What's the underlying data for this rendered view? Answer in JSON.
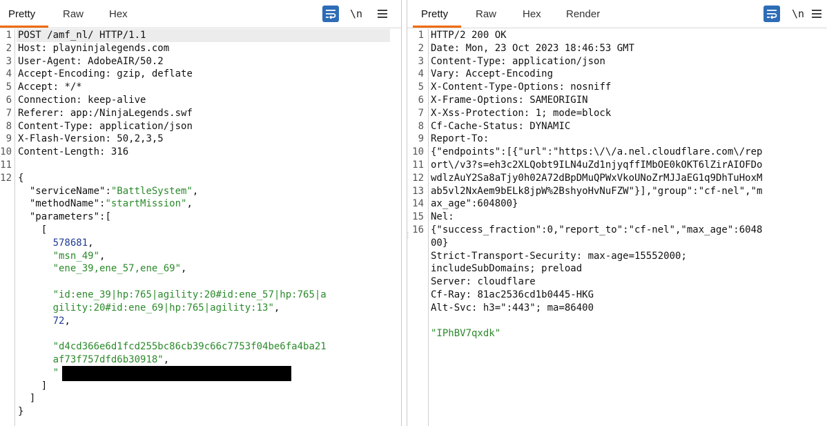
{
  "request": {
    "tabs": [
      {
        "label": "Pretty",
        "active": true
      },
      {
        "label": "Raw",
        "active": false
      },
      {
        "label": "Hex",
        "active": false
      }
    ],
    "newline_label": "\\n",
    "line_numbers": [
      "1",
      "2",
      "3",
      "4",
      "5",
      "6",
      "7",
      "8",
      "9",
      "10",
      "11",
      "12"
    ],
    "request_line": "POST /amf_nl/ HTTP/1.1",
    "headers": [
      {
        "name": "Host",
        "value": "playninjalegends.com"
      },
      {
        "name": "User-Agent",
        "value": "AdobeAIR/50.2"
      },
      {
        "name": "Accept-Encoding",
        "value": "gzip, deflate"
      },
      {
        "name": "Accept",
        "value": "*/*"
      },
      {
        "name": "Connection",
        "value": "keep-alive"
      },
      {
        "name": "Referer",
        "value": "app:/NinjaLegends.swf"
      },
      {
        "name": "Content-Type",
        "value": "application/json"
      },
      {
        "name": "X-Flash-Version",
        "value": "50,2,3,5"
      },
      {
        "name": "Content-Length",
        "value": "316"
      }
    ],
    "body": {
      "serviceName_key": "\"serviceName\"",
      "serviceName_val": "\"BattleSystem\"",
      "methodName_key": "\"methodName\"",
      "methodName_val": "\"startMission\"",
      "parameters_key": "\"parameters\"",
      "p1": "578681",
      "p2": "\"msn_49\"",
      "p3": "\"ene_39,ene_57,ene_69\"",
      "p4_line1": "\"id:ene_39|hp:765|agility:20#id:ene_57|hp:765|a",
      "p4_line2": "gility:20#id:ene_69|hp:765|agility:13\"",
      "p5": "72",
      "p6_line1": "\"d4cd366e6d1fcd255bc86cb39c66c7753f04be6fa4ba21",
      "p6_line2": "af73f757dfd6b30918\""
    }
  },
  "response": {
    "tabs": [
      {
        "label": "Pretty",
        "active": true
      },
      {
        "label": "Raw",
        "active": false
      },
      {
        "label": "Hex",
        "active": false
      },
      {
        "label": "Render",
        "active": false
      }
    ],
    "newline_label": "\\n",
    "status_line": "HTTP/2 200 OK",
    "headers": [
      {
        "num": "2",
        "name": "Date",
        "value": "Mon, 23 Oct 2023 18:46:53 GMT"
      },
      {
        "num": "3",
        "name": "Content-Type",
        "value": "application/json"
      },
      {
        "num": "4",
        "name": "Vary",
        "value": "Accept-Encoding"
      },
      {
        "num": "5",
        "name": "X-Content-Type-Options",
        "value": "nosniff"
      },
      {
        "num": "6",
        "name": "X-Frame-Options",
        "value": "SAMEORIGIN"
      },
      {
        "num": "7",
        "name": "X-Xss-Protection",
        "value": "1; mode=block"
      },
      {
        "num": "8",
        "name": "Cf-Cache-Status",
        "value": "DYNAMIC"
      }
    ],
    "report_to_name": "Report-To",
    "report_to_lines": [
      "{\"endpoints\":[{\"url\":\"https:\\/\\/a.nel.cloudflare.com\\/rep",
      "ort\\/v3?s=eh3c2XLQobt9ILN4uZd1njyqffIMbOE0kOKT6lZirAIOFDo",
      "wdlzAuY2Sa8aTjy0h02A72dBpDMuQPWxVkoUNoZrMJJaEG1q9DhTuHoxM",
      "ab5vl2NxAem9bELk8jpW%2BshyoHvNuFZW\"}],\"group\":\"cf-nel\",\"m",
      "ax_age\":604800}"
    ],
    "nel_name": "Nel",
    "nel_lines": [
      "{\"success_fraction\":0,\"report_to\":\"cf-nel\",\"max_age\":6048",
      "00}"
    ],
    "hsts_name": "Strict-Transport-Security",
    "hsts_line1": "max-age=15552000;",
    "hsts_line2": "includeSubDomains; preload",
    "server_name": "Server",
    "server_value": "cloudflare",
    "cfray_name": "Cf-Ray",
    "cfray_value": "81ac2536cd1b0445-HKG",
    "altsvc_name": "Alt-Svc",
    "altsvc_value": "h3=\":443\"; ma=86400",
    "body_value": "\"IPhBV7qxdk\"",
    "line_numbers": [
      "1",
      "2",
      "3",
      "4",
      "5",
      "6",
      "7",
      "8",
      "9",
      "",
      "",
      "",
      "",
      "10",
      "",
      "11",
      "",
      "12",
      "13",
      "14",
      "15",
      "16"
    ]
  }
}
